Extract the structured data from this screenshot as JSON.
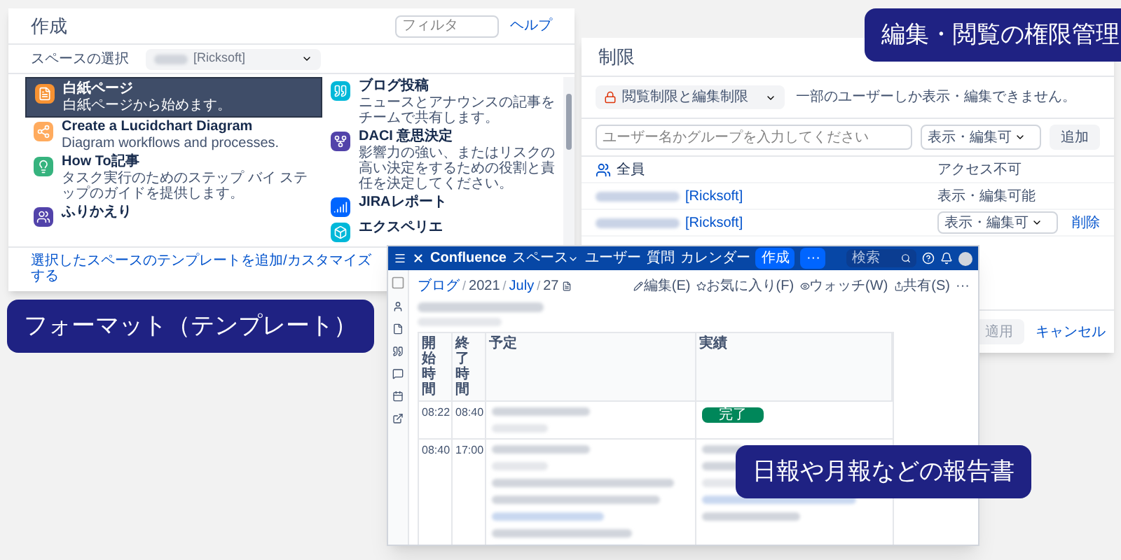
{
  "create_dialog": {
    "title": "作成",
    "filter": {
      "placeholder": "フィルタ"
    },
    "help_link": "ヘルプ",
    "space_label": "スペースの選択",
    "space_value": "[Ricksoft]",
    "templates_left": [
      {
        "kind": "page",
        "title": "白紙ページ",
        "description": "白紙ページから始めます。",
        "selected": true
      },
      {
        "kind": "lucid",
        "title": "Create a Lucidchart Diagram",
        "description": "Diagram workflows and processes.",
        "selected": false
      },
      {
        "kind": "howto",
        "title": "How To記事",
        "description": "タスク実行のためのステップ バイ ステップのガイドを提供します。",
        "selected": false
      },
      {
        "kind": "retro",
        "title": "ふりかえり",
        "selected": false
      }
    ],
    "templates_right": [
      {
        "kind": "blog",
        "title": "ブログ投稿",
        "description": "ニュースとアナウンスの記事をチームで共有します。",
        "selected": false
      },
      {
        "kind": "daci",
        "title": "DACI 意思決定",
        "description": "影響力の強い、またはリスクの高い決定をするための役割と責任を決定してください。",
        "selected": false
      },
      {
        "kind": "jira",
        "title": "JIRAレポート",
        "selected": false
      },
      {
        "kind": "experience",
        "title": "エクスペリエ",
        "selected": false
      }
    ],
    "footer_link": "選択したスペースのテンプレートを追加/カスタマイズする"
  },
  "restrictions_dialog": {
    "title": "制限",
    "mode": "閲覧制限と編集制限",
    "mode_note": "一部のユーザーしか表示・編集できません。",
    "user_input": {
      "placeholder": "ユーザー名かグループを入力してください"
    },
    "permission_select": "表示・編集可",
    "add_button": "追加",
    "entries": [
      {
        "kind": "group",
        "name": "全員",
        "permission": "アクセス不可"
      },
      {
        "kind": "user",
        "name": "[Ricksoft]",
        "permission": "表示・編集可能"
      },
      {
        "kind": "user-select",
        "name": "[Ricksoft]",
        "permission": "表示・編集可",
        "remove": "削除"
      }
    ],
    "apply_button": {
      "label": "適用",
      "disabled": true
    },
    "cancel_button": "キャンセル"
  },
  "confluence_page": {
    "nav": {
      "logo": "Confluence",
      "items": [
        {
          "label": "スペース",
          "dropdown": true
        },
        {
          "label": "ユーザー",
          "dropdown": false
        },
        {
          "label": "質問",
          "dropdown": false
        },
        {
          "label": "カレンダー",
          "dropdown": false
        }
      ],
      "create_button": "作成",
      "more_button": "···",
      "search": {
        "placeholder": "検索"
      }
    },
    "breadcrumb": {
      "separator": "/",
      "items": [
        {
          "label": "ブログ",
          "link": true
        },
        {
          "label": "2021",
          "link": false
        },
        {
          "label": "July",
          "link": true
        },
        {
          "label": "27",
          "link": false
        }
      ]
    },
    "actions": [
      {
        "kind": "edit",
        "label": "編集(E)"
      },
      {
        "kind": "star",
        "label": "お気に入り(F)"
      },
      {
        "kind": "watch",
        "label": "ウォッチ(W)"
      },
      {
        "kind": "share",
        "label": "共有(S)"
      }
    ],
    "more_actions": "···",
    "table": {
      "columns": [
        "開始時間",
        "終了時間",
        "予定",
        "実績"
      ],
      "rows": [
        {
          "start": "08:22",
          "end": "08:40",
          "status": "完了"
        },
        {
          "start": "08:40",
          "end": "17:00"
        }
      ]
    }
  },
  "callouts": [
    {
      "text": "編集・閲覧の権限管理"
    },
    {
      "text": "フォーマット（テンプレート）"
    },
    {
      "text": "日報や月報などの報告書"
    }
  ]
}
